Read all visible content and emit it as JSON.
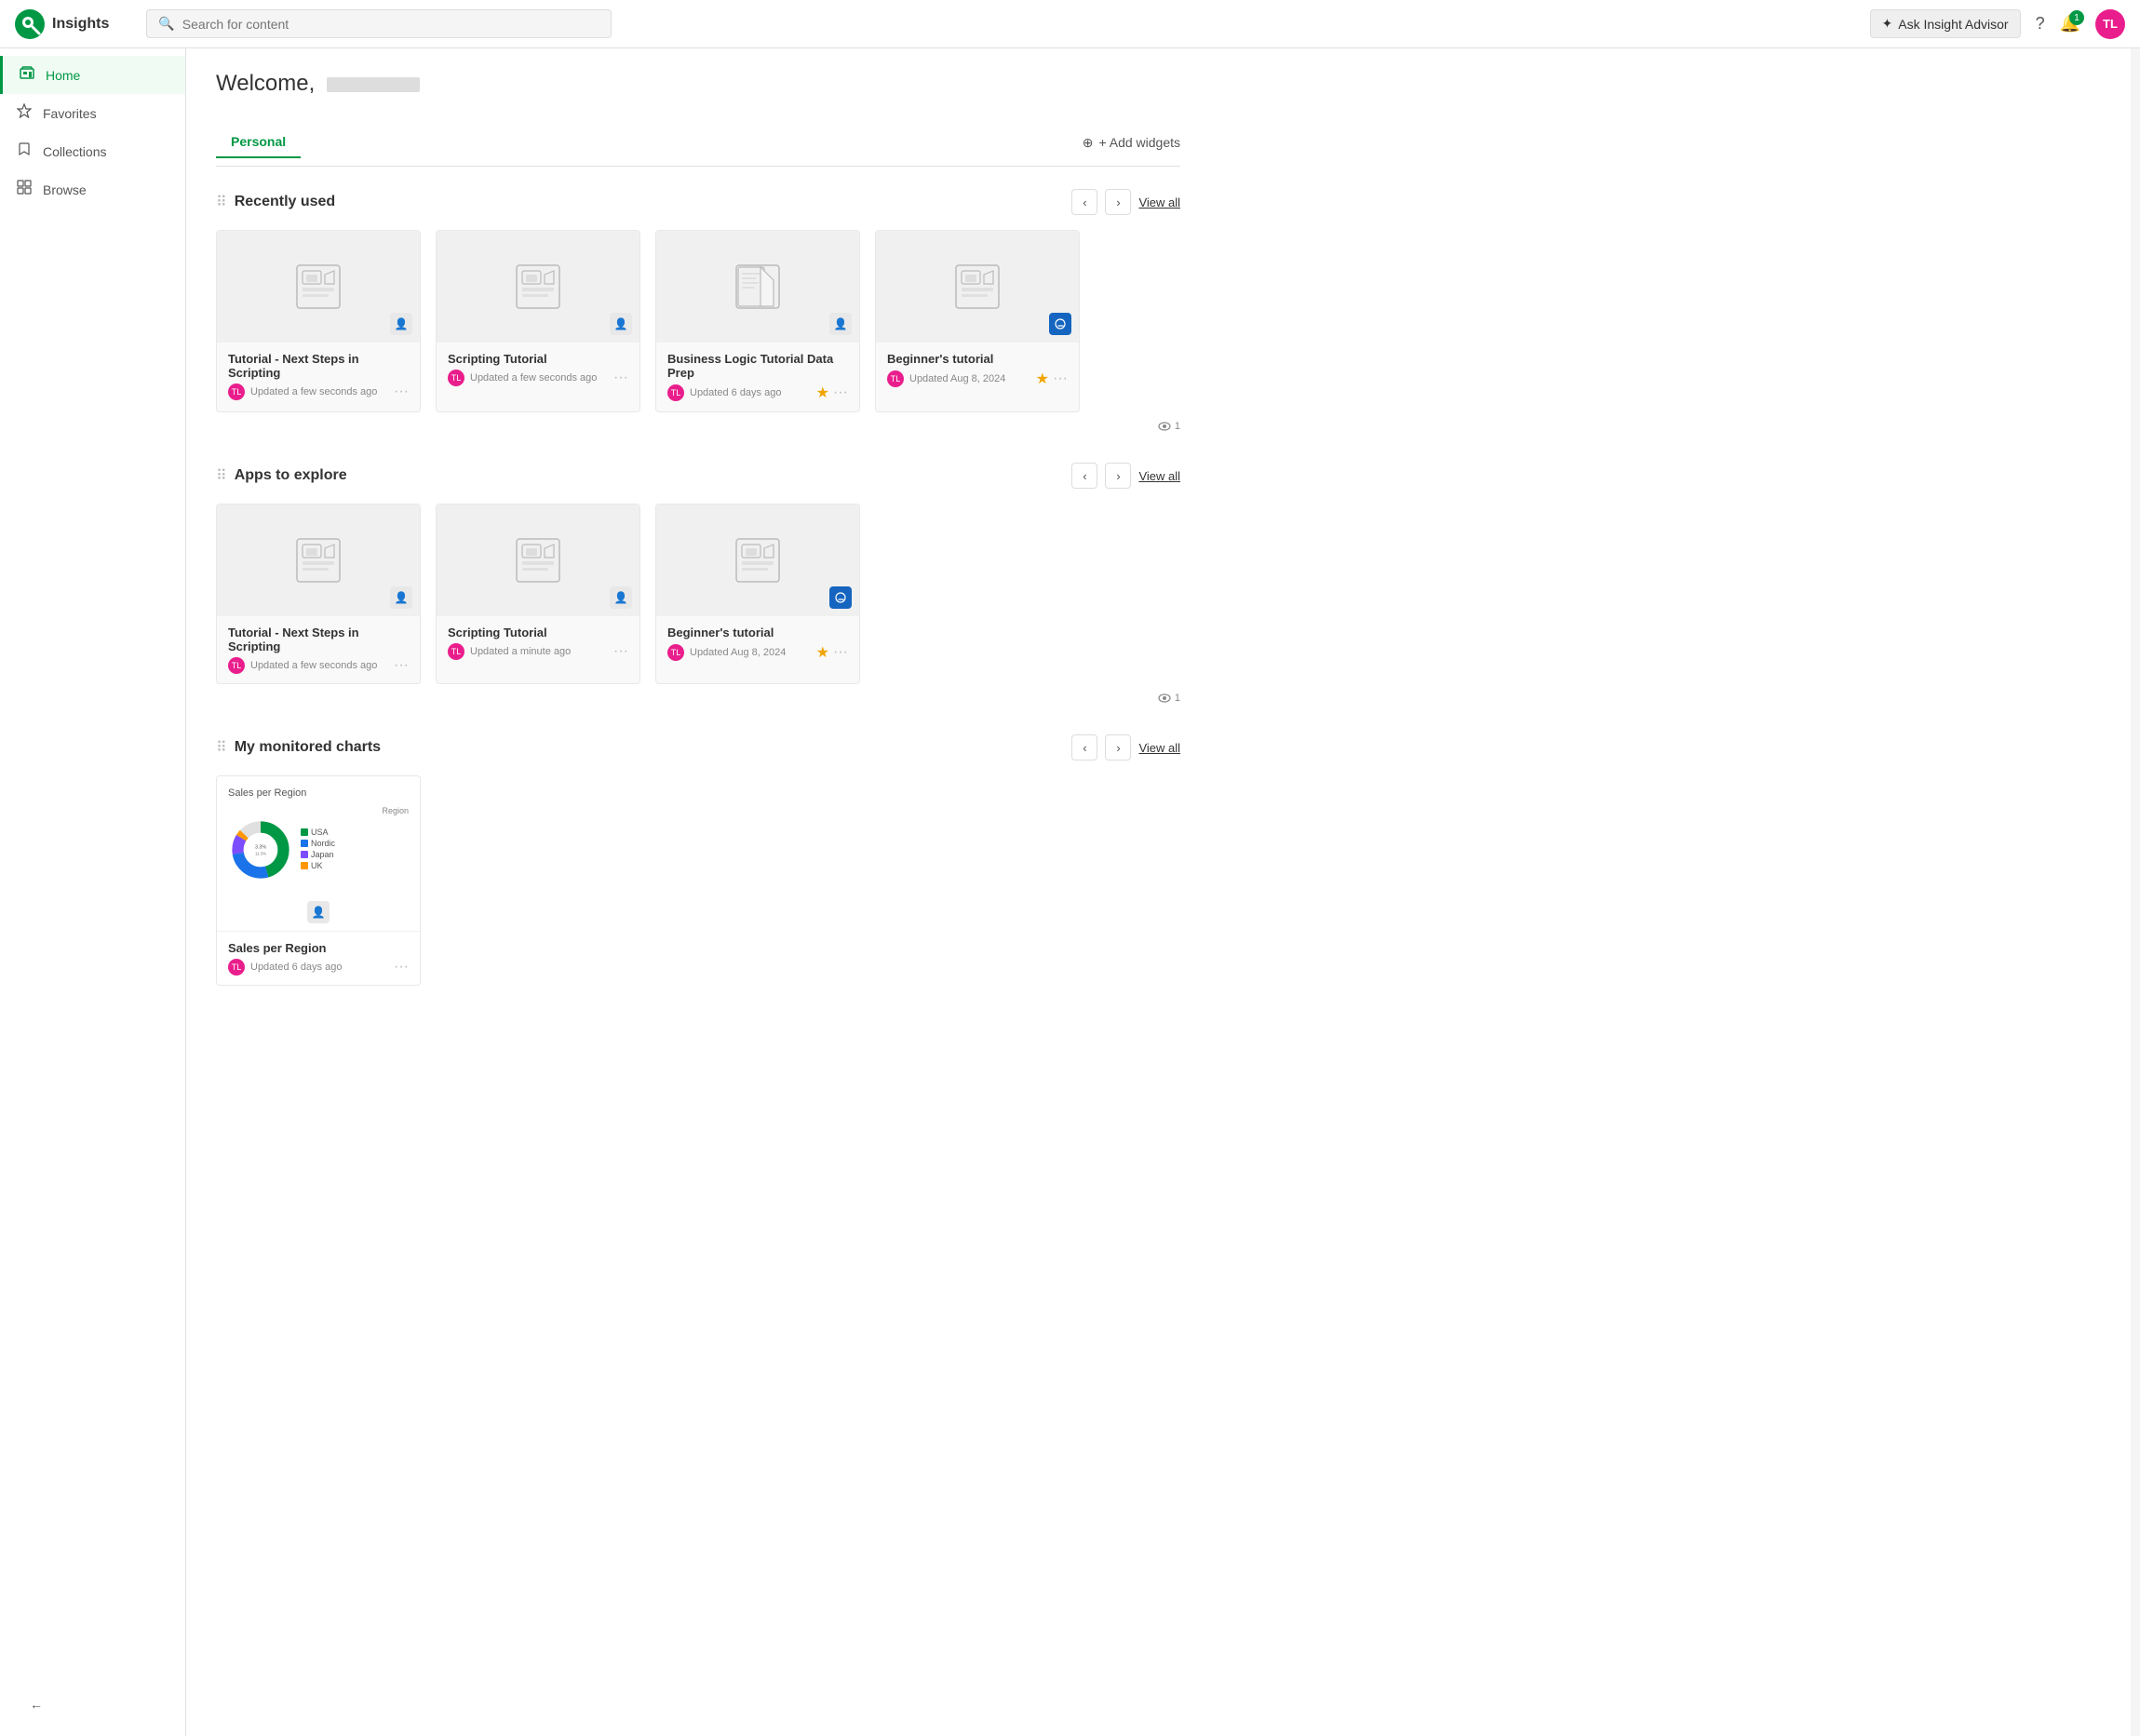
{
  "app": {
    "title": "Insights",
    "logo_text": "Qlik"
  },
  "topnav": {
    "search_placeholder": "Search for content",
    "ask_advisor_label": "Ask Insight Advisor",
    "notification_count": "1",
    "avatar_initials": "TL"
  },
  "sidebar": {
    "items": [
      {
        "id": "home",
        "label": "Home",
        "icon": "⊞",
        "active": true
      },
      {
        "id": "favorites",
        "label": "Favorites",
        "icon": "☆",
        "active": false
      },
      {
        "id": "collections",
        "label": "Collections",
        "icon": "🔖",
        "active": false
      },
      {
        "id": "browse",
        "label": "Browse",
        "icon": "▦",
        "active": false
      }
    ]
  },
  "main": {
    "welcome_text": "Welcome,",
    "tabs": [
      {
        "id": "personal",
        "label": "Personal",
        "active": true
      }
    ],
    "add_widgets_label": "+ Add widgets",
    "sections": {
      "recently_used": {
        "title": "Recently used",
        "view_all": "View all",
        "cards": [
          {
            "title": "Tutorial - Next Steps in Scripting",
            "meta": "Updated a few seconds ago",
            "icon_type": "person",
            "starred": false
          },
          {
            "title": "Scripting Tutorial",
            "meta": "Updated a few seconds ago",
            "icon_type": "person",
            "starred": false
          },
          {
            "title": "Business Logic Tutorial Data Prep",
            "meta": "Updated 6 days ago",
            "icon_type": "person",
            "starred": true
          },
          {
            "title": "Beginner's tutorial",
            "meta": "Updated Aug 8, 2024",
            "icon_type": "blue",
            "starred": true
          }
        ],
        "view_count": "1"
      },
      "apps_to_explore": {
        "title": "Apps to explore",
        "view_all": "View all",
        "cards": [
          {
            "title": "Tutorial - Next Steps in Scripting",
            "meta": "Updated a few seconds ago",
            "icon_type": "person",
            "starred": false
          },
          {
            "title": "Scripting Tutorial",
            "meta": "Updated a minute ago",
            "icon_type": "person",
            "starred": false
          },
          {
            "title": "Beginner's tutorial",
            "meta": "Updated Aug 8, 2024",
            "icon_type": "blue",
            "starred": true
          }
        ],
        "view_count": "1"
      },
      "my_monitored_charts": {
        "title": "My monitored charts",
        "view_all": "View all",
        "chart": {
          "title": "Sales per Region",
          "meta": "Updated 6 days ago",
          "chart_title": "Sales per Region",
          "legend_region": "Region",
          "slices": [
            {
              "label": "USA",
              "value": 45.5,
              "color": "#009845",
              "percent": "45.5%"
            },
            {
              "label": "Nordic",
              "value": 26.9,
              "color": "#1a73e8",
              "percent": "26.9%"
            },
            {
              "label": "Japan",
              "value": 11.3,
              "color": "#7c4dff",
              "percent": "11.3%"
            },
            {
              "label": "UK",
              "value": 3.3,
              "color": "#ff9800",
              "percent": "3.3%"
            }
          ]
        }
      }
    }
  }
}
